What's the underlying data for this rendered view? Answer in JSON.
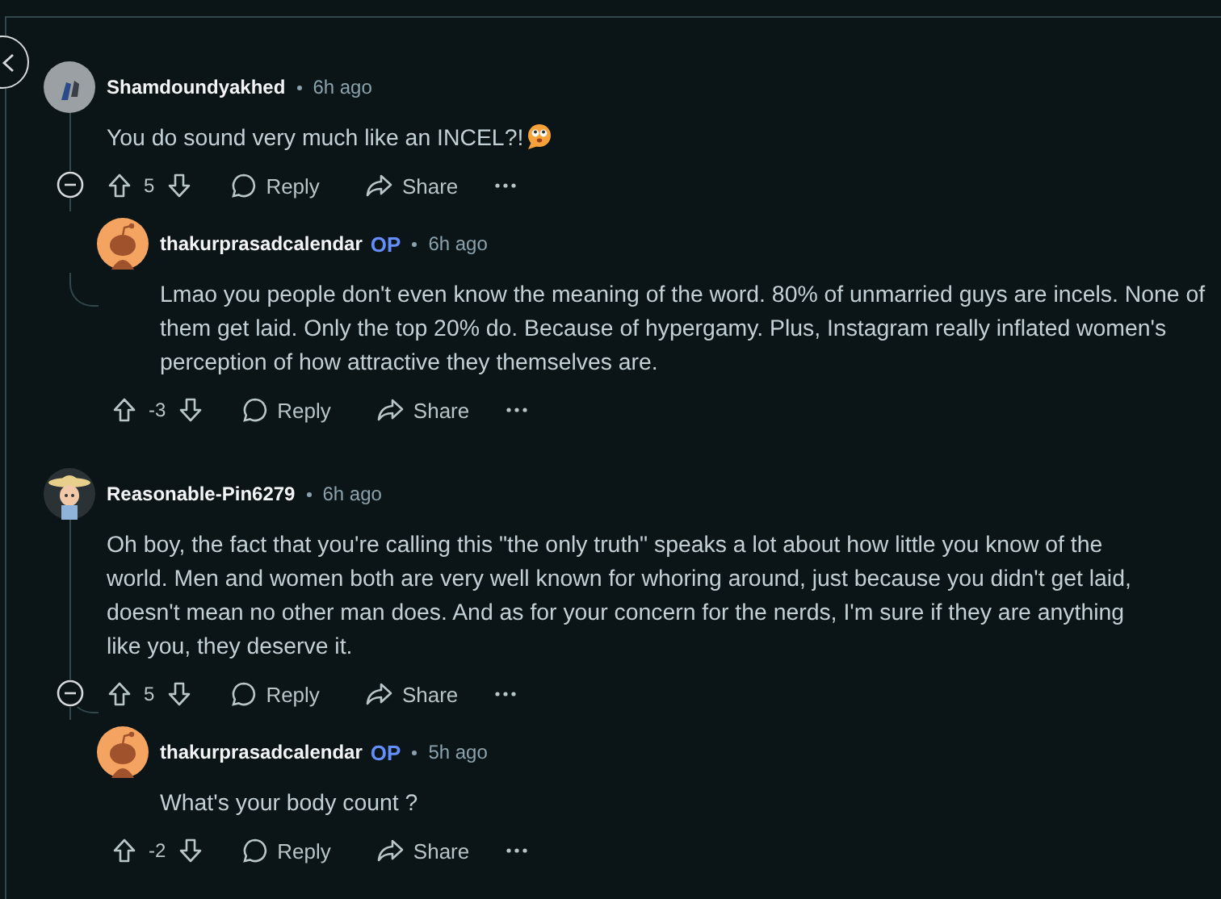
{
  "comments": [
    {
      "author": "Shamdoundyakhed",
      "time": "6h ago",
      "kind": "photo",
      "body": "You do sound very much like an INCEL?!",
      "emoji": true,
      "score": "5",
      "reply_label": "Reply",
      "share_label": "Share",
      "collapsible": true,
      "children": [
        {
          "author": "thakurprasadcalendar",
          "flair": "OP",
          "time": "6h ago",
          "kind": "snoo",
          "body": "Lmao you people don't even know the meaning of the word. 80% of unmarried guys are incels. None of them get laid. Only the top 20% do. Because of hypergamy. Plus, Instagram really inflated women's perception of how attractive they themselves are.",
          "emoji": false,
          "score": "-3",
          "reply_label": "Reply",
          "share_label": "Share",
          "collapsible": false
        }
      ]
    },
    {
      "author": "Reasonable-Pin6279",
      "time": "6h ago",
      "kind": "cartoon",
      "body": "Oh boy, the fact that you're calling this \"the only truth\" speaks a lot about how little you know of the world. Men and women both are very well known for whoring around, just because you didn't get laid, doesn't mean no other man does. And as for your concern for the nerds, I'm sure if they are anything like you, they deserve it.",
      "emoji": false,
      "score": "5",
      "reply_label": "Reply",
      "share_label": "Share",
      "collapsible": true,
      "children": [
        {
          "author": "thakurprasadcalendar",
          "flair": "OP",
          "time": "5h ago",
          "kind": "snoo",
          "body": "What's your body count ?",
          "emoji": false,
          "score": "-2",
          "reply_label": "Reply",
          "share_label": "Share",
          "collapsible": false
        }
      ]
    }
  ]
}
